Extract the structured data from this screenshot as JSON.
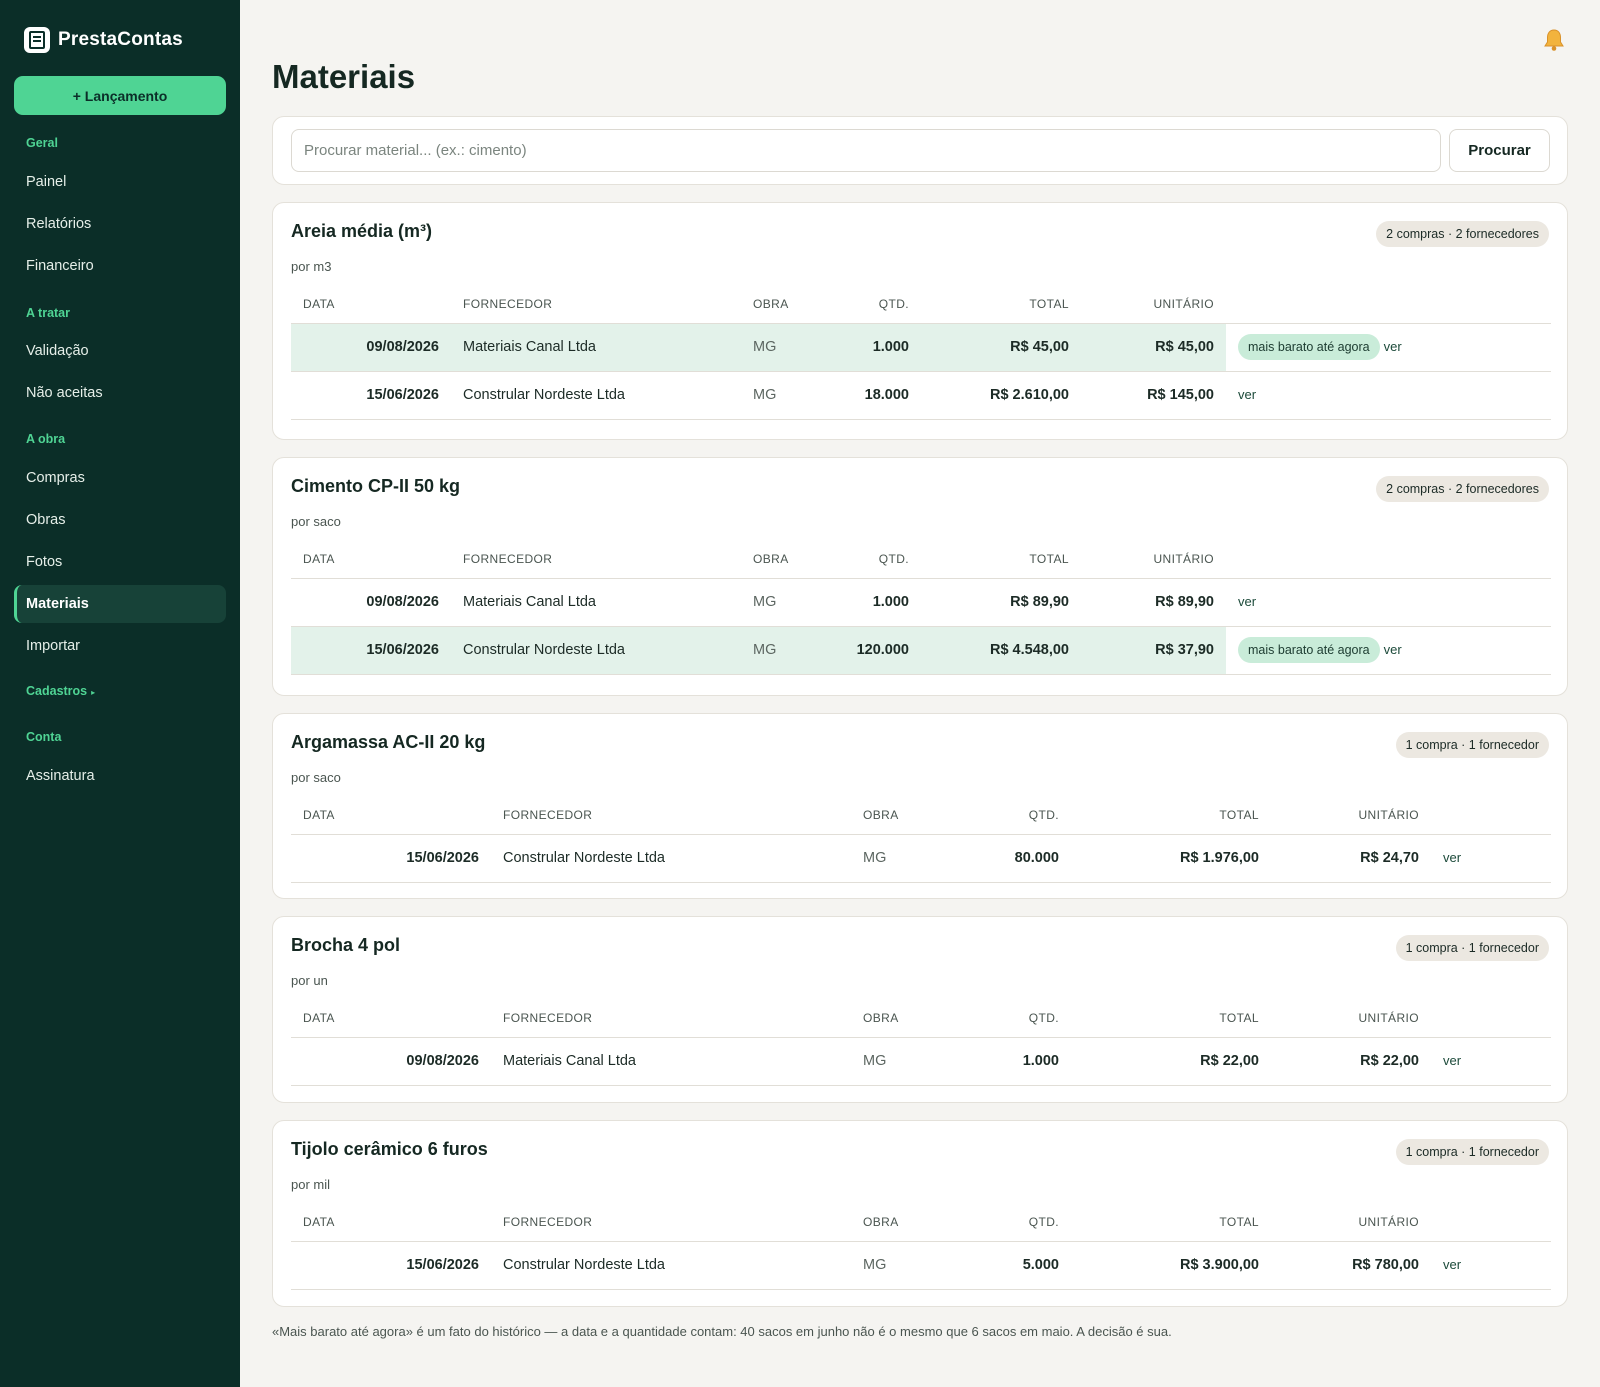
{
  "app": {
    "name": "PrestaContas",
    "new_button": "+ Lançamento"
  },
  "nav": {
    "sections": [
      {
        "label": "Geral",
        "items": [
          "Painel",
          "Relatórios",
          "Financeiro"
        ]
      },
      {
        "label": "A tratar",
        "items": [
          "Validação",
          "Não aceitas"
        ]
      },
      {
        "label": "A obra",
        "items": [
          "Compras",
          "Obras",
          "Fotos",
          "Materiais",
          "Importar"
        ]
      },
      {
        "label": "Cadastros",
        "items": []
      },
      {
        "label": "Conta",
        "items": [
          "Assinatura"
        ]
      }
    ],
    "active": "Materiais"
  },
  "page": {
    "title": "Materiais"
  },
  "search": {
    "placeholder": "Procurar material... (ex.: cimento)",
    "value": "",
    "button": "Procurar"
  },
  "columns": {
    "date": "DATA",
    "supplier": "FORNECEDOR",
    "site": "OBRA",
    "qty": "QTD.",
    "total": "TOTAL",
    "unit": "UNITÁRIO"
  },
  "labels": {
    "cheapest": "mais barato até agora",
    "view": "ver"
  },
  "materials": [
    {
      "name": "Areia média (m³)",
      "unit_label": "por m3",
      "badge": "2 compras · 2 fornecedores",
      "rows": [
        {
          "date": "09/08/2026",
          "supplier": "Materiais Canal Ltda",
          "site": "MG",
          "qty": "1.000",
          "total": "R$ 45,00",
          "unit": "R$ 45,00",
          "cheapest": true
        },
        {
          "date": "15/06/2026",
          "supplier": "Constrular Nordeste Ltda",
          "site": "MG",
          "qty": "18.000",
          "total": "R$ 2.610,00",
          "unit": "R$ 145,00",
          "cheapest": false
        }
      ]
    },
    {
      "name": "Cimento CP-II 50 kg",
      "unit_label": "por saco",
      "badge": "2 compras · 2 fornecedores",
      "rows": [
        {
          "date": "09/08/2026",
          "supplier": "Materiais Canal Ltda",
          "site": "MG",
          "qty": "1.000",
          "total": "R$ 89,90",
          "unit": "R$ 89,90",
          "cheapest": false
        },
        {
          "date": "15/06/2026",
          "supplier": "Constrular Nordeste Ltda",
          "site": "MG",
          "qty": "120.000",
          "total": "R$ 4.548,00",
          "unit": "R$ 37,90",
          "cheapest": true
        }
      ]
    },
    {
      "name": "Argamassa AC-II 20 kg",
      "unit_label": "por saco",
      "badge": "1 compra · 1 fornecedor",
      "rows": [
        {
          "date": "15/06/2026",
          "supplier": "Constrular Nordeste Ltda",
          "site": "MG",
          "qty": "80.000",
          "total": "R$ 1.976,00",
          "unit": "R$ 24,70",
          "cheapest": false
        }
      ]
    },
    {
      "name": "Brocha 4 pol",
      "unit_label": "por un",
      "badge": "1 compra · 1 fornecedor",
      "rows": [
        {
          "date": "09/08/2026",
          "supplier": "Materiais Canal Ltda",
          "site": "MG",
          "qty": "1.000",
          "total": "R$ 22,00",
          "unit": "R$ 22,00",
          "cheapest": false
        }
      ]
    },
    {
      "name": "Tijolo cerâmico 6 furos",
      "unit_label": "por mil",
      "badge": "1 compra · 1 fornecedor",
      "rows": [
        {
          "date": "15/06/2026",
          "supplier": "Constrular Nordeste Ltda",
          "site": "MG",
          "qty": "5.000",
          "total": "R$ 3.900,00",
          "unit": "R$ 780,00",
          "cheapest": false
        }
      ]
    }
  ],
  "footnote": "«Mais barato até agora» é um fato do histórico — a data e a quantidade contam: 40 sacos em junho não é o mesmo que 6 sacos em maio. A decisão é sua.",
  "colors": {
    "sidebar": "#0b2e28",
    "accent": "#4fd494",
    "highlight_row": "#e3f2ea",
    "tag": "#c9ecd9"
  }
}
